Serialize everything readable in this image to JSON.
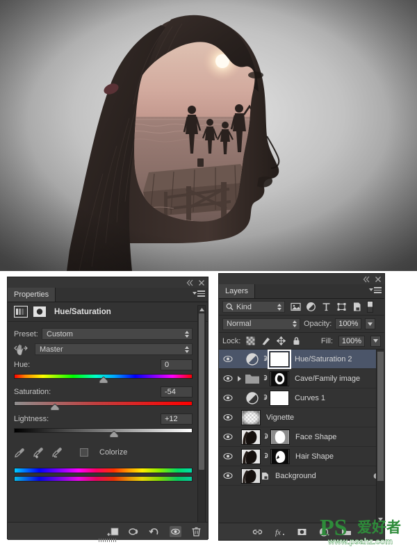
{
  "canvas": {
    "name": "double-exposure-portrait",
    "description": "Double exposure of a woman's profile silhouette containing a sunset beach pier scene with family silhouettes",
    "background_color": "#6d6d6d",
    "sky_color": "#c9a9a0",
    "sun_color": "#fff6e0"
  },
  "properties_panel": {
    "tab_label": "Properties",
    "title": "Hue/Saturation",
    "icons": {
      "adjustment_properties": "adjustment-properties-icon",
      "mask_properties": "mask-properties-icon",
      "targeted_adjustment": "targeted-adjustment-hand-icon",
      "collapse": "collapse-icon",
      "close": "close-icon",
      "panel_menu": "panel-menu-icon"
    },
    "preset": {
      "label": "Preset:",
      "value": "Custom"
    },
    "channel": {
      "value": "Master"
    },
    "sliders": [
      {
        "label": "Hue:",
        "value": "0",
        "percent": 50,
        "track": "hue"
      },
      {
        "label": "Saturation:",
        "value": "-54",
        "percent": 23,
        "track": "sat"
      },
      {
        "label": "Lightness:",
        "value": "+12",
        "percent": 56,
        "track": "light"
      }
    ],
    "colorize": {
      "label": "Colorize",
      "checked": false
    },
    "eyedroppers": [
      "eyedropper-icon",
      "eyedropper-add-icon",
      "eyedropper-subtract-icon"
    ],
    "footer_icons": [
      "clip-to-layer-icon",
      "view-previous-state-icon",
      "reset-icon",
      "toggle-visibility-icon",
      "delete-icon"
    ]
  },
  "layers_panel": {
    "tab_label": "Layers",
    "icons": {
      "collapse": "collapse-icon",
      "close": "close-icon",
      "panel_menu": "panel-menu-icon",
      "search": "search-icon"
    },
    "filter": {
      "kind_label": "Kind",
      "type_icons": [
        "filter-pixel-layers-icon",
        "filter-adjustment-layers-icon",
        "filter-type-layers-icon",
        "filter-shape-layers-icon",
        "filter-smart-objects-icon"
      ],
      "toggle": "filter-enable-toggle"
    },
    "blend_mode": "Normal",
    "opacity": {
      "label": "Opacity:",
      "value": "100%"
    },
    "fill": {
      "label": "Fill:",
      "value": "100%"
    },
    "lock": {
      "label": "Lock:",
      "icons": [
        "lock-transparent-pixels-icon",
        "lock-image-pixels-icon",
        "lock-position-icon",
        "lock-all-icon"
      ]
    },
    "layers": [
      {
        "name": "Hue/Saturation 2",
        "visible": true,
        "selected": true,
        "type": "adjustment",
        "has_link": true,
        "mask": "white",
        "thumb_selected": true
      },
      {
        "name": "Cave/Family image",
        "visible": true,
        "selected": false,
        "type": "group",
        "has_link": true,
        "mask": "silhouette",
        "expandable": true
      },
      {
        "name": "Curves 1",
        "visible": true,
        "selected": false,
        "type": "adjustment",
        "has_link": true,
        "mask": "white"
      },
      {
        "name": "Vignette",
        "visible": true,
        "selected": false,
        "type": "pixel",
        "has_link": false,
        "mask": "checker"
      },
      {
        "name": "Face Shape",
        "visible": true,
        "selected": false,
        "type": "pixel",
        "has_link": true,
        "mask": "face-white"
      },
      {
        "name": "Hair Shape",
        "visible": true,
        "selected": false,
        "type": "pixel",
        "has_link": true,
        "mask": "hair-white"
      },
      {
        "name": "Background",
        "visible": true,
        "selected": false,
        "type": "background",
        "has_link": false,
        "locked": true
      }
    ],
    "footer_icons": [
      "link-layers-icon",
      "layer-style-fx-icon",
      "add-layer-mask-icon",
      "new-adjustment-layer-icon",
      "new-group-icon"
    ]
  },
  "watermark": {
    "logo_text": "PS",
    "cn_text": "爱好者",
    "url": "www.psahz.com",
    "color": "#2e8b3a"
  }
}
